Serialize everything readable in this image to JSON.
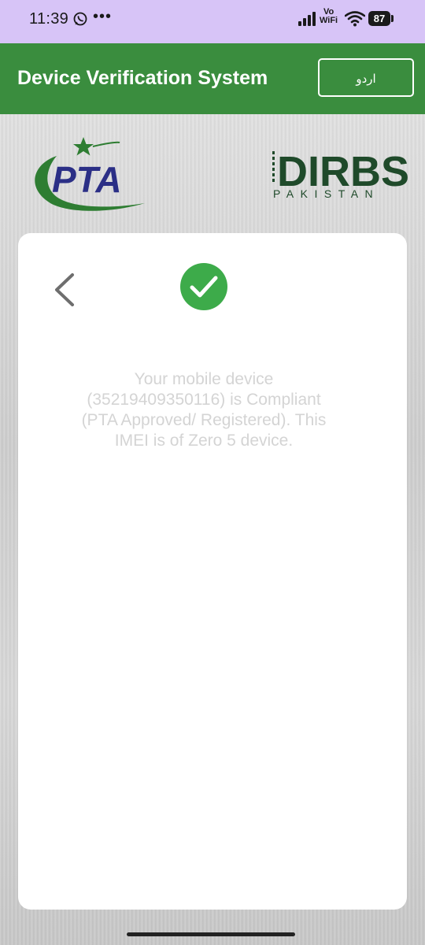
{
  "status_bar": {
    "time": "11:39",
    "more": "•••",
    "vowifi_top": "Vo",
    "vowifi_bottom": "WiFi",
    "battery": "87",
    "icons": [
      "whatsapp-icon",
      "signal-icon",
      "wifi-icon",
      "battery-icon"
    ]
  },
  "app_bar": {
    "title": "Device Verification System",
    "language_button": "اردو"
  },
  "logos": {
    "pta_text": "PTA",
    "dirbs_text": "DIRBS",
    "dirbs_sub": "PAKISTAN"
  },
  "card": {
    "message": "Your mobile device (35219409350116) is Compliant (PTA Approved/ Registered). This IMEI is of Zero 5 device.",
    "icons": [
      "back-chevron-icon",
      "success-check-icon"
    ]
  },
  "colors": {
    "status_bar_bg": "#d7c4f7",
    "app_bar_bg": "#3a8d3e",
    "success_green": "#3dab4a",
    "pta_blue": "#2b2f86",
    "pta_green": "#2e7d32",
    "dirbs_green": "#1f4a2a",
    "message_text": "#d4d4d4"
  }
}
